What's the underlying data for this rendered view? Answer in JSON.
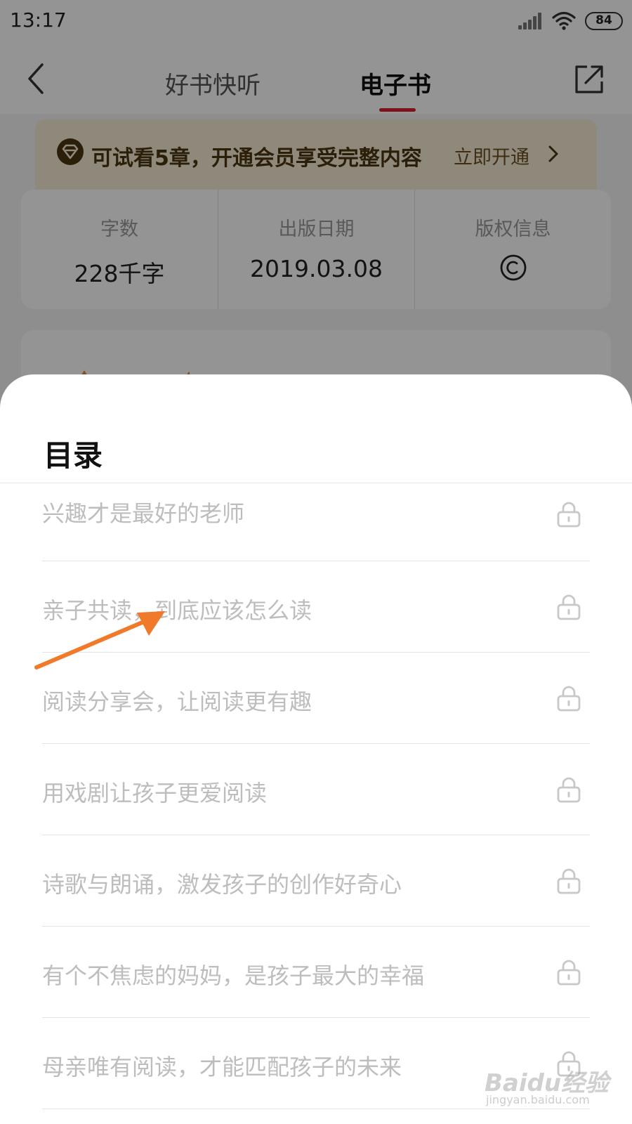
{
  "status_bar": {
    "time": "13:17",
    "battery": "84"
  },
  "nav": {
    "tabs": [
      {
        "label": "好书快听"
      },
      {
        "label": "电子书",
        "active": true
      }
    ]
  },
  "member_banner": {
    "text": "可试看5章，开通会员享受完整内容",
    "action": "立即开通"
  },
  "book_info": [
    {
      "label": "字数",
      "value": "228千字"
    },
    {
      "label": "出版日期",
      "value": "2019.03.08"
    },
    {
      "label": "版权信息",
      "icon": "copyright-icon"
    }
  ],
  "toc": {
    "title": "目录",
    "chapters": [
      {
        "title": "兴趣才是最好的老师",
        "locked": true
      },
      {
        "title": "亲子共读，到底应该怎么读",
        "locked": true
      },
      {
        "title": "阅读分享会，让阅读更有趣",
        "locked": true
      },
      {
        "title": "用戏剧让孩子更爱阅读",
        "locked": true
      },
      {
        "title": "诗歌与朗诵，激发孩子的创作好奇心",
        "locked": true
      },
      {
        "title": "有个不焦虑的妈妈，是孩子最大的幸福",
        "locked": true
      },
      {
        "title": "母亲唯有阅读，才能匹配孩子的未来",
        "locked": true
      }
    ]
  },
  "watermark": {
    "text": "Baidu经验",
    "subtext": "jingyan.baidu.com"
  },
  "colors": {
    "accent": "#d8202a",
    "banner_bg": "#f7ecd5",
    "banner_text": "#4a3612",
    "arrow": "#f07a2a",
    "chapter_text": "#bdbdbd"
  }
}
